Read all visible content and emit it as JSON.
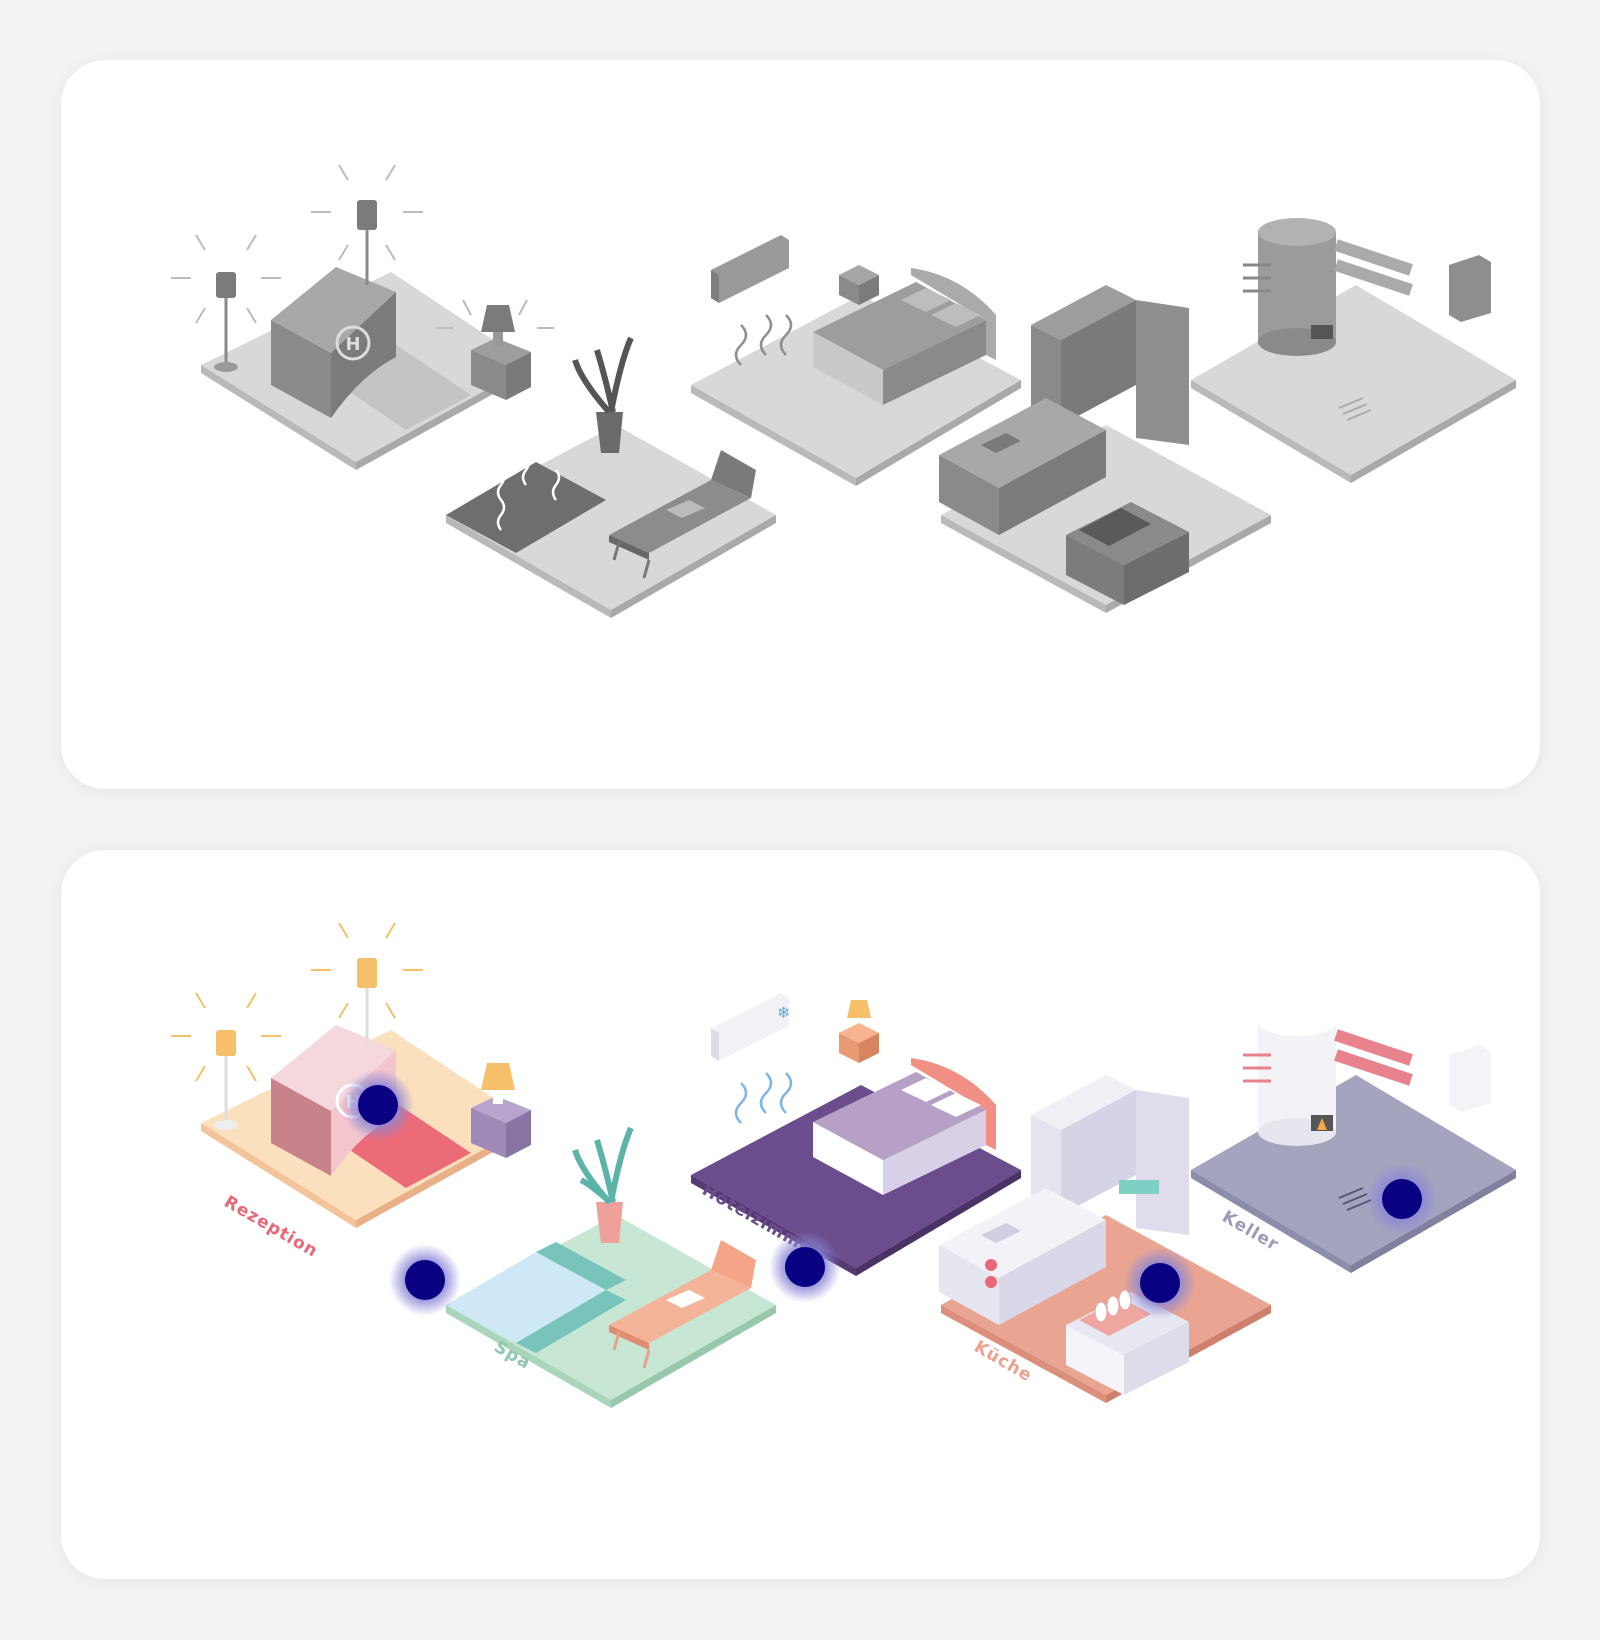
{
  "logo": {
    "letter": "H"
  },
  "rooms": [
    {
      "id": "rezeption",
      "label": "Rezeption",
      "color": "#e8687a"
    },
    {
      "id": "spa",
      "label": "Spa",
      "color": "#8fc7b0"
    },
    {
      "id": "hotelzimmer",
      "label": "Hotelzimmer",
      "color": "#6b4c8c"
    },
    {
      "id": "kueche",
      "label": "Küche",
      "color": "#eda08e"
    },
    {
      "id": "keller",
      "label": "Keller",
      "color": "#9b9bb6"
    }
  ],
  "colors": {
    "hotspot": "#0a0082",
    "hotspot_halo": "#8a86d6",
    "lamp_glow": "#f6c06a",
    "gray_floor": "#d9d9d9",
    "gray_object": "#8f8f8f"
  }
}
